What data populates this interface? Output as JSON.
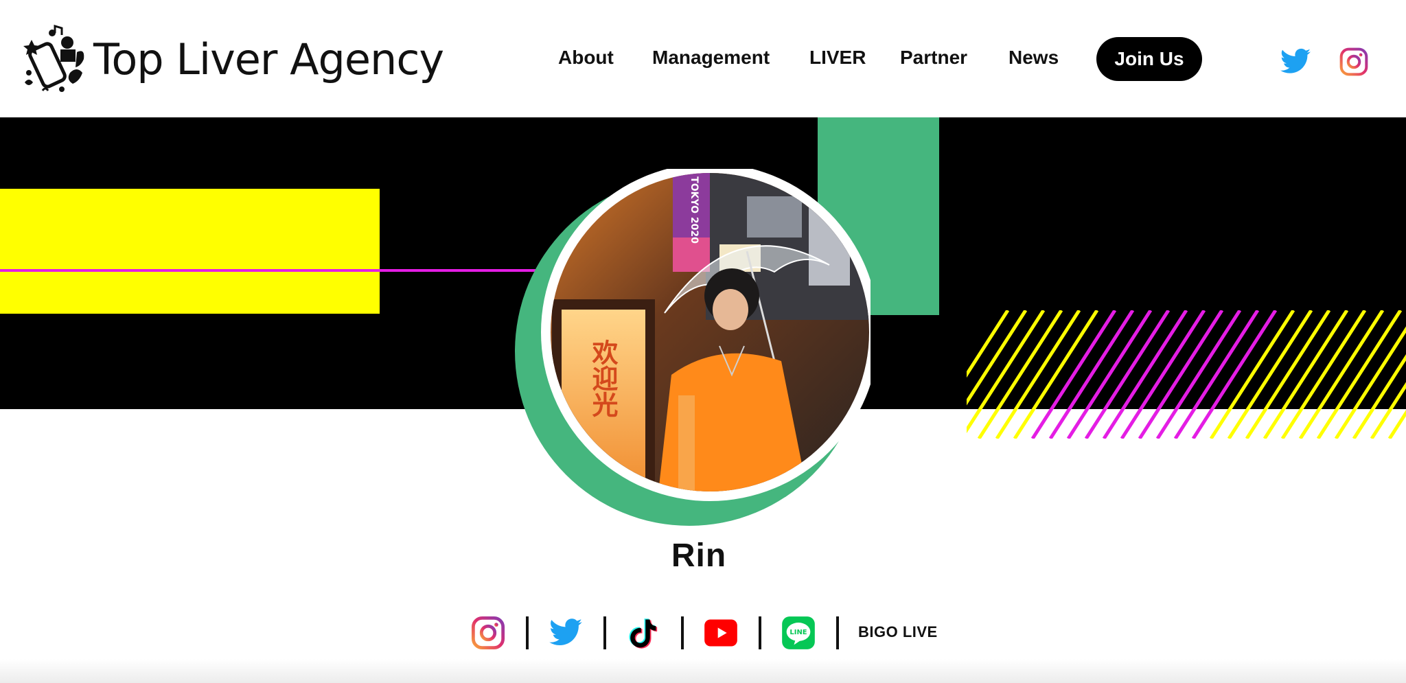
{
  "brand": {
    "name": "Top Liver Agency"
  },
  "nav": {
    "items": [
      {
        "label": "About"
      },
      {
        "label": "Management"
      },
      {
        "label": "LIVER"
      },
      {
        "label": "Partner"
      },
      {
        "label": "News"
      }
    ],
    "join_label": "Join Us"
  },
  "header_social": [
    "twitter-icon",
    "instagram-icon"
  ],
  "profile": {
    "name": "Rin",
    "photo_text": "TOKYO 2020",
    "photo_sign": "欢迎光"
  },
  "social_links": {
    "icons": [
      "instagram-icon",
      "twitter-icon",
      "tiktok-icon",
      "youtube-icon",
      "line-icon"
    ],
    "line_label": "LINE",
    "bigo_label": "BIGO LIVE"
  },
  "colors": {
    "yellow": "#ffff00",
    "magenta": "#e41de4",
    "green": "#45b67e",
    "black": "#000000",
    "twitter": "#1da1f2"
  }
}
